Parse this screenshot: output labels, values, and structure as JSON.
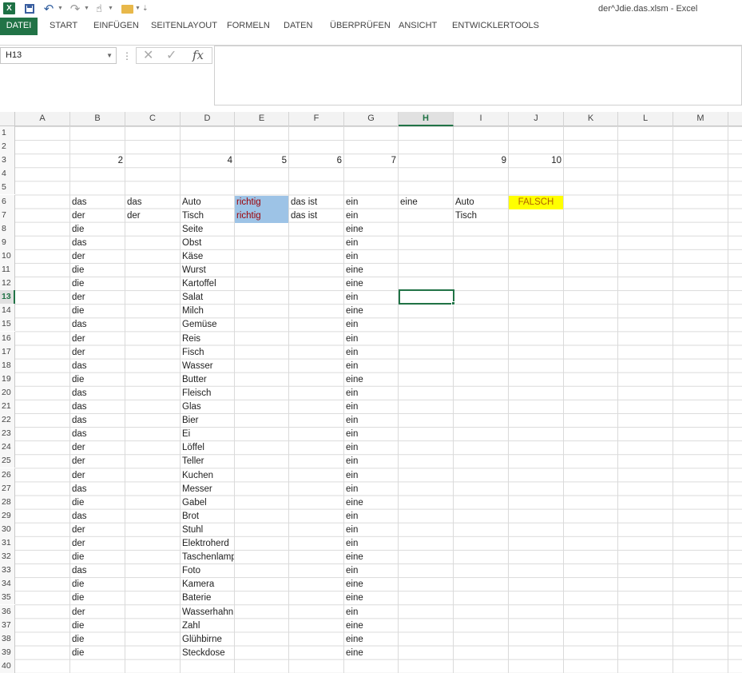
{
  "window": {
    "title": "der^Jdie.das.xlsm - Excel"
  },
  "quick_access": {
    "logo_text": "X"
  },
  "ribbon": {
    "tabs": [
      {
        "label": "DATEI"
      },
      {
        "label": "START"
      },
      {
        "label": "EINFÜGEN"
      },
      {
        "label": "SEITENLAYOUT"
      },
      {
        "label": "FORMELN"
      },
      {
        "label": "DATEN"
      },
      {
        "label": "ÜBERPRÜFEN"
      },
      {
        "label": "ANSICHT"
      },
      {
        "label": "ENTWICKLERTOOLS"
      }
    ]
  },
  "formula_bar": {
    "name_box": "H13",
    "formula": ""
  },
  "sheet": {
    "selected_cell": "H13",
    "columns": [
      "A",
      "B",
      "C",
      "D",
      "E",
      "F",
      "G",
      "H",
      "I",
      "J",
      "K",
      "L",
      "M"
    ],
    "rows": [
      "1",
      "2",
      "3",
      "4",
      "5",
      "6",
      "7",
      "8",
      "9",
      "10",
      "11",
      "12",
      "13",
      "14",
      "15",
      "16",
      "17",
      "18",
      "19",
      "20",
      "21",
      "22",
      "23",
      "24",
      "25",
      "26",
      "27",
      "28",
      "29",
      "30",
      "31",
      "32",
      "33",
      "34",
      "35",
      "36",
      "37",
      "38",
      "39",
      "40"
    ],
    "row3_numbers": [
      "2",
      "4",
      "5",
      "6",
      "7",
      "9",
      "10"
    ],
    "row6": {
      "b": "das",
      "c": "das",
      "d": "Auto",
      "e": "richtig",
      "f": "das ist",
      "g": "ein",
      "h": "eine",
      "i": "Auto",
      "j": "FALSCH"
    },
    "row7": {
      "b": "der",
      "c": "der",
      "d": "Tisch",
      "e": "richtig",
      "f": "das ist",
      "g": "ein",
      "i": "Tisch"
    },
    "list": [
      {
        "article": "die",
        "noun": "Seite",
        "indef": "eine"
      },
      {
        "article": "das",
        "noun": "Obst",
        "indef": "ein"
      },
      {
        "article": "der",
        "noun": "Käse",
        "indef": "ein"
      },
      {
        "article": "die",
        "noun": "Wurst",
        "indef": "eine"
      },
      {
        "article": "die",
        "noun": "Kartoffel",
        "indef": "eine"
      },
      {
        "article": "der",
        "noun": "Salat",
        "indef": "ein"
      },
      {
        "article": "die",
        "noun": "Milch",
        "indef": "eine"
      },
      {
        "article": "das",
        "noun": "Gemüse",
        "indef": "ein"
      },
      {
        "article": "der",
        "noun": "Reis",
        "indef": "ein"
      },
      {
        "article": "der",
        "noun": "Fisch",
        "indef": "ein"
      },
      {
        "article": "das",
        "noun": "Wasser",
        "indef": "ein"
      },
      {
        "article": "die",
        "noun": "Butter",
        "indef": "eine"
      },
      {
        "article": "das",
        "noun": "Fleisch",
        "indef": "ein"
      },
      {
        "article": "das",
        "noun": "Glas",
        "indef": "ein"
      },
      {
        "article": "das",
        "noun": "Bier",
        "indef": "ein"
      },
      {
        "article": "das",
        "noun": "Ei",
        "indef": "ein"
      },
      {
        "article": "der",
        "noun": "Löffel",
        "indef": "ein"
      },
      {
        "article": "der",
        "noun": "Teller",
        "indef": "ein"
      },
      {
        "article": "der",
        "noun": "Kuchen",
        "indef": "ein"
      },
      {
        "article": "das",
        "noun": "Messer",
        "indef": "ein"
      },
      {
        "article": "die",
        "noun": "Gabel",
        "indef": "eine"
      },
      {
        "article": "das",
        "noun": "Brot",
        "indef": "ein"
      },
      {
        "article": "der",
        "noun": "Stuhl",
        "indef": "ein"
      },
      {
        "article": "der",
        "noun": "Elektroherd",
        "indef": "ein"
      },
      {
        "article": "die",
        "noun": "Taschenlampe",
        "indef": "eine"
      },
      {
        "article": "das",
        "noun": "Foto",
        "indef": "ein"
      },
      {
        "article": "die",
        "noun": "Kamera",
        "indef": "eine"
      },
      {
        "article": "die",
        "noun": "Baterie",
        "indef": "eine"
      },
      {
        "article": "der",
        "noun": "Wasserhahn",
        "indef": "ein"
      },
      {
        "article": "die",
        "noun": "Zahl",
        "indef": "eine"
      },
      {
        "article": "die",
        "noun": "Glühbirne",
        "indef": "eine"
      },
      {
        "article": "die",
        "noun": "Steckdose",
        "indef": "eine"
      }
    ]
  },
  "colors": {
    "accent": "#217346",
    "richtig_fill": "#9dc3e6",
    "richtig_text": "#9c0006",
    "falsch_fill": "#ffff00"
  }
}
